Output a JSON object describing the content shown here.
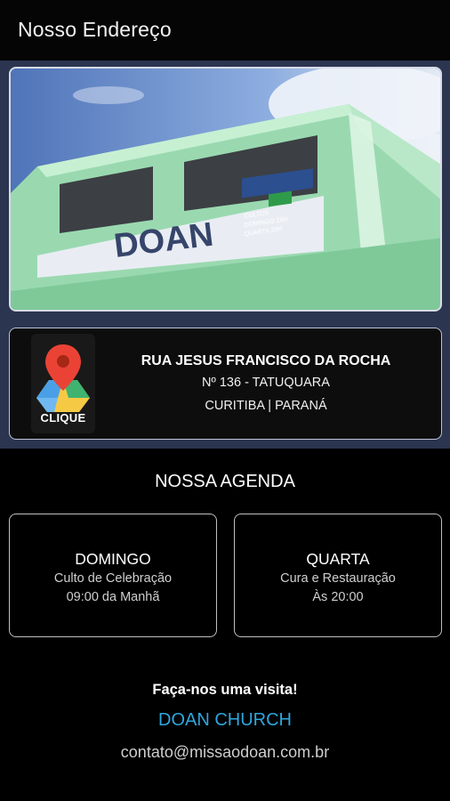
{
  "appbar": {
    "title": "Nosso Endereço"
  },
  "photo": {
    "sign_text": "DOAN",
    "side_sign": [
      "CULTOS",
      "DOMINGO 19H",
      "QUARTA 20H"
    ]
  },
  "address": {
    "button_label": "CLIQUE",
    "street": "RUA JESUS FRANCISCO DA ROCHA",
    "number": "Nº 136 - TATUQUARA",
    "city": "CURITIBA | PARANÁ"
  },
  "agenda": {
    "title": "NOSSA AGENDA",
    "days": [
      {
        "day": "DOMINGO",
        "event": "Culto de Celebração",
        "time": "09:00 da Manhã"
      },
      {
        "day": "QUARTA",
        "event": "Cura e Restauração",
        "time": "Às 20:00"
      }
    ]
  },
  "footer": {
    "visit": "Faça-nos uma visita!",
    "church": "DOAN CHURCH",
    "email": "contato@missaodoan.com.br"
  },
  "colors": {
    "header_bg": "#050505",
    "top_section_bg": "#2b3550",
    "accent_link": "#2fa6de",
    "building_green": "#8fd3a8",
    "pin_red": "#ea4335"
  }
}
